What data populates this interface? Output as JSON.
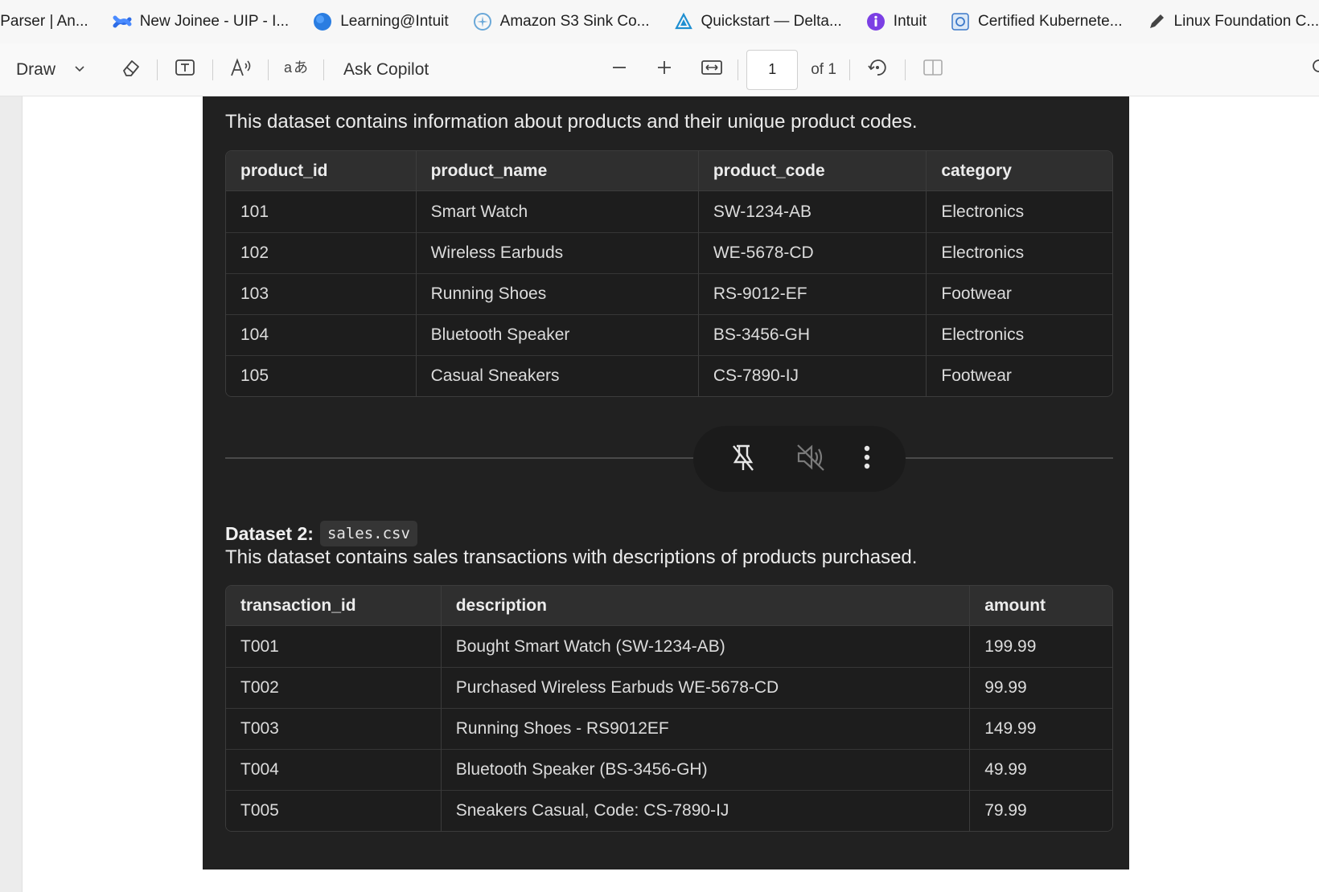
{
  "bookmarks": [
    {
      "label": "lParser | An...",
      "icon": "none"
    },
    {
      "label": "New Joinee - UIP - I...",
      "icon": "confluence-icon"
    },
    {
      "label": "Learning@Intuit",
      "icon": "globe-icon"
    },
    {
      "label": "Amazon S3 Sink Co...",
      "icon": "confluent-icon"
    },
    {
      "label": "Quickstart — Delta...",
      "icon": "delta-icon"
    },
    {
      "label": "Intuit",
      "icon": "intuit-icon"
    },
    {
      "label": "Certified Kubernete...",
      "icon": "kubernetes-icon"
    },
    {
      "label": "Linux Foundation C...",
      "icon": "pen-icon"
    }
  ],
  "toolbar": {
    "draw_label": "Draw",
    "ask_copilot_label": "Ask Copilot",
    "page_number": "1",
    "page_total": "of 1"
  },
  "document": {
    "dataset1": {
      "description": "This dataset contains information about products and their unique product codes.",
      "columns": [
        "product_id",
        "product_name",
        "product_code",
        "category"
      ],
      "rows": [
        [
          "101",
          "Smart Watch",
          "SW-1234-AB",
          "Electronics"
        ],
        [
          "102",
          "Wireless Earbuds",
          "WE-5678-CD",
          "Electronics"
        ],
        [
          "103",
          "Running Shoes",
          "RS-9012-EF",
          "Footwear"
        ],
        [
          "104",
          "Bluetooth Speaker",
          "BS-3456-GH",
          "Electronics"
        ],
        [
          "105",
          "Casual Sneakers",
          "CS-7890-IJ",
          "Footwear"
        ]
      ]
    },
    "dataset2": {
      "heading": "Dataset 2:",
      "filename": "sales.csv",
      "description": "This dataset contains sales transactions with descriptions of products purchased.",
      "columns": [
        "transaction_id",
        "description",
        "amount"
      ],
      "rows": [
        [
          "T001",
          "Bought Smart Watch (SW-1234-AB)",
          "199.99"
        ],
        [
          "T002",
          "Purchased Wireless Earbuds WE-5678-CD",
          "99.99"
        ],
        [
          "T003",
          "Running Shoes - RS9012EF",
          "149.99"
        ],
        [
          "T004",
          "Bluetooth Speaker (BS-3456-GH)",
          "49.99"
        ],
        [
          "T005",
          "Sneakers Casual, Code: CS-7890-IJ",
          "79.99"
        ]
      ]
    }
  },
  "media_controls": [
    "unpin-icon",
    "mute-icon",
    "more-options-icon"
  ],
  "colors": {
    "page_background": "#212121",
    "accent": "#1f6feb"
  }
}
